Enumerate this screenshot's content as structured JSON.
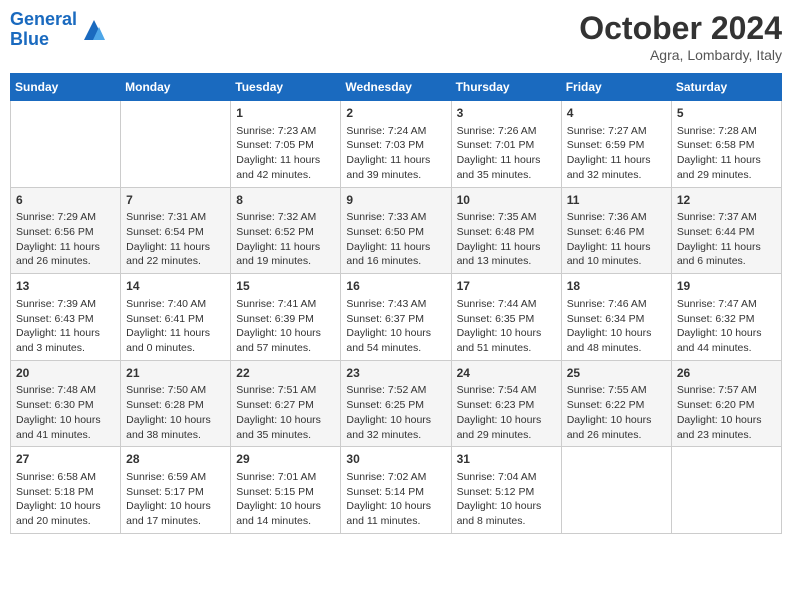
{
  "header": {
    "logo_line1": "General",
    "logo_line2": "Blue",
    "month": "October 2024",
    "location": "Agra, Lombardy, Italy"
  },
  "days_of_week": [
    "Sunday",
    "Monday",
    "Tuesday",
    "Wednesday",
    "Thursday",
    "Friday",
    "Saturday"
  ],
  "weeks": [
    [
      {
        "day": "",
        "content": ""
      },
      {
        "day": "",
        "content": ""
      },
      {
        "day": "1",
        "content": "Sunrise: 7:23 AM\nSunset: 7:05 PM\nDaylight: 11 hours and 42 minutes."
      },
      {
        "day": "2",
        "content": "Sunrise: 7:24 AM\nSunset: 7:03 PM\nDaylight: 11 hours and 39 minutes."
      },
      {
        "day": "3",
        "content": "Sunrise: 7:26 AM\nSunset: 7:01 PM\nDaylight: 11 hours and 35 minutes."
      },
      {
        "day": "4",
        "content": "Sunrise: 7:27 AM\nSunset: 6:59 PM\nDaylight: 11 hours and 32 minutes."
      },
      {
        "day": "5",
        "content": "Sunrise: 7:28 AM\nSunset: 6:58 PM\nDaylight: 11 hours and 29 minutes."
      }
    ],
    [
      {
        "day": "6",
        "content": "Sunrise: 7:29 AM\nSunset: 6:56 PM\nDaylight: 11 hours and 26 minutes."
      },
      {
        "day": "7",
        "content": "Sunrise: 7:31 AM\nSunset: 6:54 PM\nDaylight: 11 hours and 22 minutes."
      },
      {
        "day": "8",
        "content": "Sunrise: 7:32 AM\nSunset: 6:52 PM\nDaylight: 11 hours and 19 minutes."
      },
      {
        "day": "9",
        "content": "Sunrise: 7:33 AM\nSunset: 6:50 PM\nDaylight: 11 hours and 16 minutes."
      },
      {
        "day": "10",
        "content": "Sunrise: 7:35 AM\nSunset: 6:48 PM\nDaylight: 11 hours and 13 minutes."
      },
      {
        "day": "11",
        "content": "Sunrise: 7:36 AM\nSunset: 6:46 PM\nDaylight: 11 hours and 10 minutes."
      },
      {
        "day": "12",
        "content": "Sunrise: 7:37 AM\nSunset: 6:44 PM\nDaylight: 11 hours and 6 minutes."
      }
    ],
    [
      {
        "day": "13",
        "content": "Sunrise: 7:39 AM\nSunset: 6:43 PM\nDaylight: 11 hours and 3 minutes."
      },
      {
        "day": "14",
        "content": "Sunrise: 7:40 AM\nSunset: 6:41 PM\nDaylight: 11 hours and 0 minutes."
      },
      {
        "day": "15",
        "content": "Sunrise: 7:41 AM\nSunset: 6:39 PM\nDaylight: 10 hours and 57 minutes."
      },
      {
        "day": "16",
        "content": "Sunrise: 7:43 AM\nSunset: 6:37 PM\nDaylight: 10 hours and 54 minutes."
      },
      {
        "day": "17",
        "content": "Sunrise: 7:44 AM\nSunset: 6:35 PM\nDaylight: 10 hours and 51 minutes."
      },
      {
        "day": "18",
        "content": "Sunrise: 7:46 AM\nSunset: 6:34 PM\nDaylight: 10 hours and 48 minutes."
      },
      {
        "day": "19",
        "content": "Sunrise: 7:47 AM\nSunset: 6:32 PM\nDaylight: 10 hours and 44 minutes."
      }
    ],
    [
      {
        "day": "20",
        "content": "Sunrise: 7:48 AM\nSunset: 6:30 PM\nDaylight: 10 hours and 41 minutes."
      },
      {
        "day": "21",
        "content": "Sunrise: 7:50 AM\nSunset: 6:28 PM\nDaylight: 10 hours and 38 minutes."
      },
      {
        "day": "22",
        "content": "Sunrise: 7:51 AM\nSunset: 6:27 PM\nDaylight: 10 hours and 35 minutes."
      },
      {
        "day": "23",
        "content": "Sunrise: 7:52 AM\nSunset: 6:25 PM\nDaylight: 10 hours and 32 minutes."
      },
      {
        "day": "24",
        "content": "Sunrise: 7:54 AM\nSunset: 6:23 PM\nDaylight: 10 hours and 29 minutes."
      },
      {
        "day": "25",
        "content": "Sunrise: 7:55 AM\nSunset: 6:22 PM\nDaylight: 10 hours and 26 minutes."
      },
      {
        "day": "26",
        "content": "Sunrise: 7:57 AM\nSunset: 6:20 PM\nDaylight: 10 hours and 23 minutes."
      }
    ],
    [
      {
        "day": "27",
        "content": "Sunrise: 6:58 AM\nSunset: 5:18 PM\nDaylight: 10 hours and 20 minutes."
      },
      {
        "day": "28",
        "content": "Sunrise: 6:59 AM\nSunset: 5:17 PM\nDaylight: 10 hours and 17 minutes."
      },
      {
        "day": "29",
        "content": "Sunrise: 7:01 AM\nSunset: 5:15 PM\nDaylight: 10 hours and 14 minutes."
      },
      {
        "day": "30",
        "content": "Sunrise: 7:02 AM\nSunset: 5:14 PM\nDaylight: 10 hours and 11 minutes."
      },
      {
        "day": "31",
        "content": "Sunrise: 7:04 AM\nSunset: 5:12 PM\nDaylight: 10 hours and 8 minutes."
      },
      {
        "day": "",
        "content": ""
      },
      {
        "day": "",
        "content": ""
      }
    ]
  ]
}
